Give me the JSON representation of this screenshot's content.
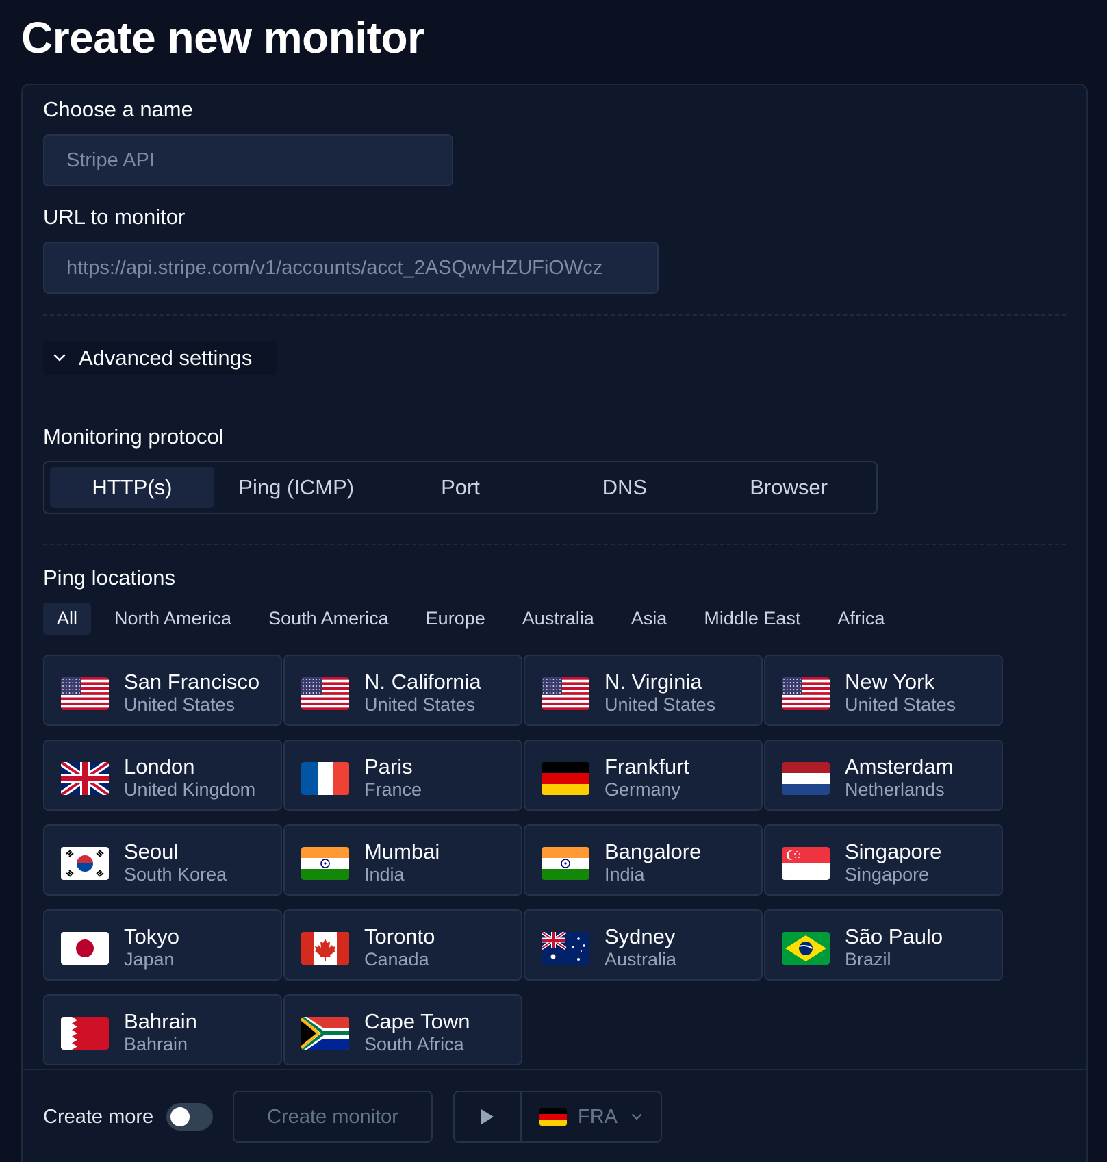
{
  "page": {
    "title": "Create new monitor"
  },
  "form": {
    "name_label": "Choose a name",
    "name_placeholder": "Stripe API",
    "url_label": "URL to monitor",
    "url_placeholder": "https://api.stripe.com/v1/accounts/acct_2ASQwvHZUFiOWcz",
    "advanced_label": "Advanced settings",
    "protocol_label": "Monitoring protocol",
    "protocols": [
      "HTTP(s)",
      "Ping (ICMP)",
      "Port",
      "DNS",
      "Browser"
    ],
    "protocol_selected": "HTTP(s)",
    "locations_label": "Ping locations",
    "region_tabs": [
      "All",
      "North America",
      "South America",
      "Europe",
      "Australia",
      "Asia",
      "Middle East",
      "Africa"
    ],
    "region_selected": "All"
  },
  "locations": [
    {
      "city": "San Francisco",
      "country": "United States",
      "flag": "us-flag-icon"
    },
    {
      "city": "N. California",
      "country": "United States",
      "flag": "us-flag-icon"
    },
    {
      "city": "N. Virginia",
      "country": "United States",
      "flag": "us-flag-icon"
    },
    {
      "city": "New York",
      "country": "United States",
      "flag": "us-flag-icon"
    },
    {
      "city": "London",
      "country": "United Kingdom",
      "flag": "uk-flag-icon"
    },
    {
      "city": "Paris",
      "country": "France",
      "flag": "fr-flag-icon"
    },
    {
      "city": "Frankfurt",
      "country": "Germany",
      "flag": "de-flag-icon"
    },
    {
      "city": "Amsterdam",
      "country": "Netherlands",
      "flag": "nl-flag-icon"
    },
    {
      "city": "Seoul",
      "country": "South Korea",
      "flag": "kr-flag-icon"
    },
    {
      "city": "Mumbai",
      "country": "India",
      "flag": "in-flag-icon"
    },
    {
      "city": "Bangalore",
      "country": "India",
      "flag": "in-flag-icon"
    },
    {
      "city": "Singapore",
      "country": "Singapore",
      "flag": "sg-flag-icon"
    },
    {
      "city": "Tokyo",
      "country": "Japan",
      "flag": "jp-flag-icon"
    },
    {
      "city": "Toronto",
      "country": "Canada",
      "flag": "ca-flag-icon"
    },
    {
      "city": "Sydney",
      "country": "Australia",
      "flag": "au-flag-icon"
    },
    {
      "city": "São Paulo",
      "country": "Brazil",
      "flag": "br-flag-icon"
    },
    {
      "city": "Bahrain",
      "country": "Bahrain",
      "flag": "bh-flag-icon"
    },
    {
      "city": "Cape Town",
      "country": "South Africa",
      "flag": "za-flag-icon"
    }
  ],
  "footer": {
    "create_more_label": "Create more",
    "create_more_enabled": false,
    "create_button_label": "Create monitor",
    "run_region": "FRA"
  }
}
